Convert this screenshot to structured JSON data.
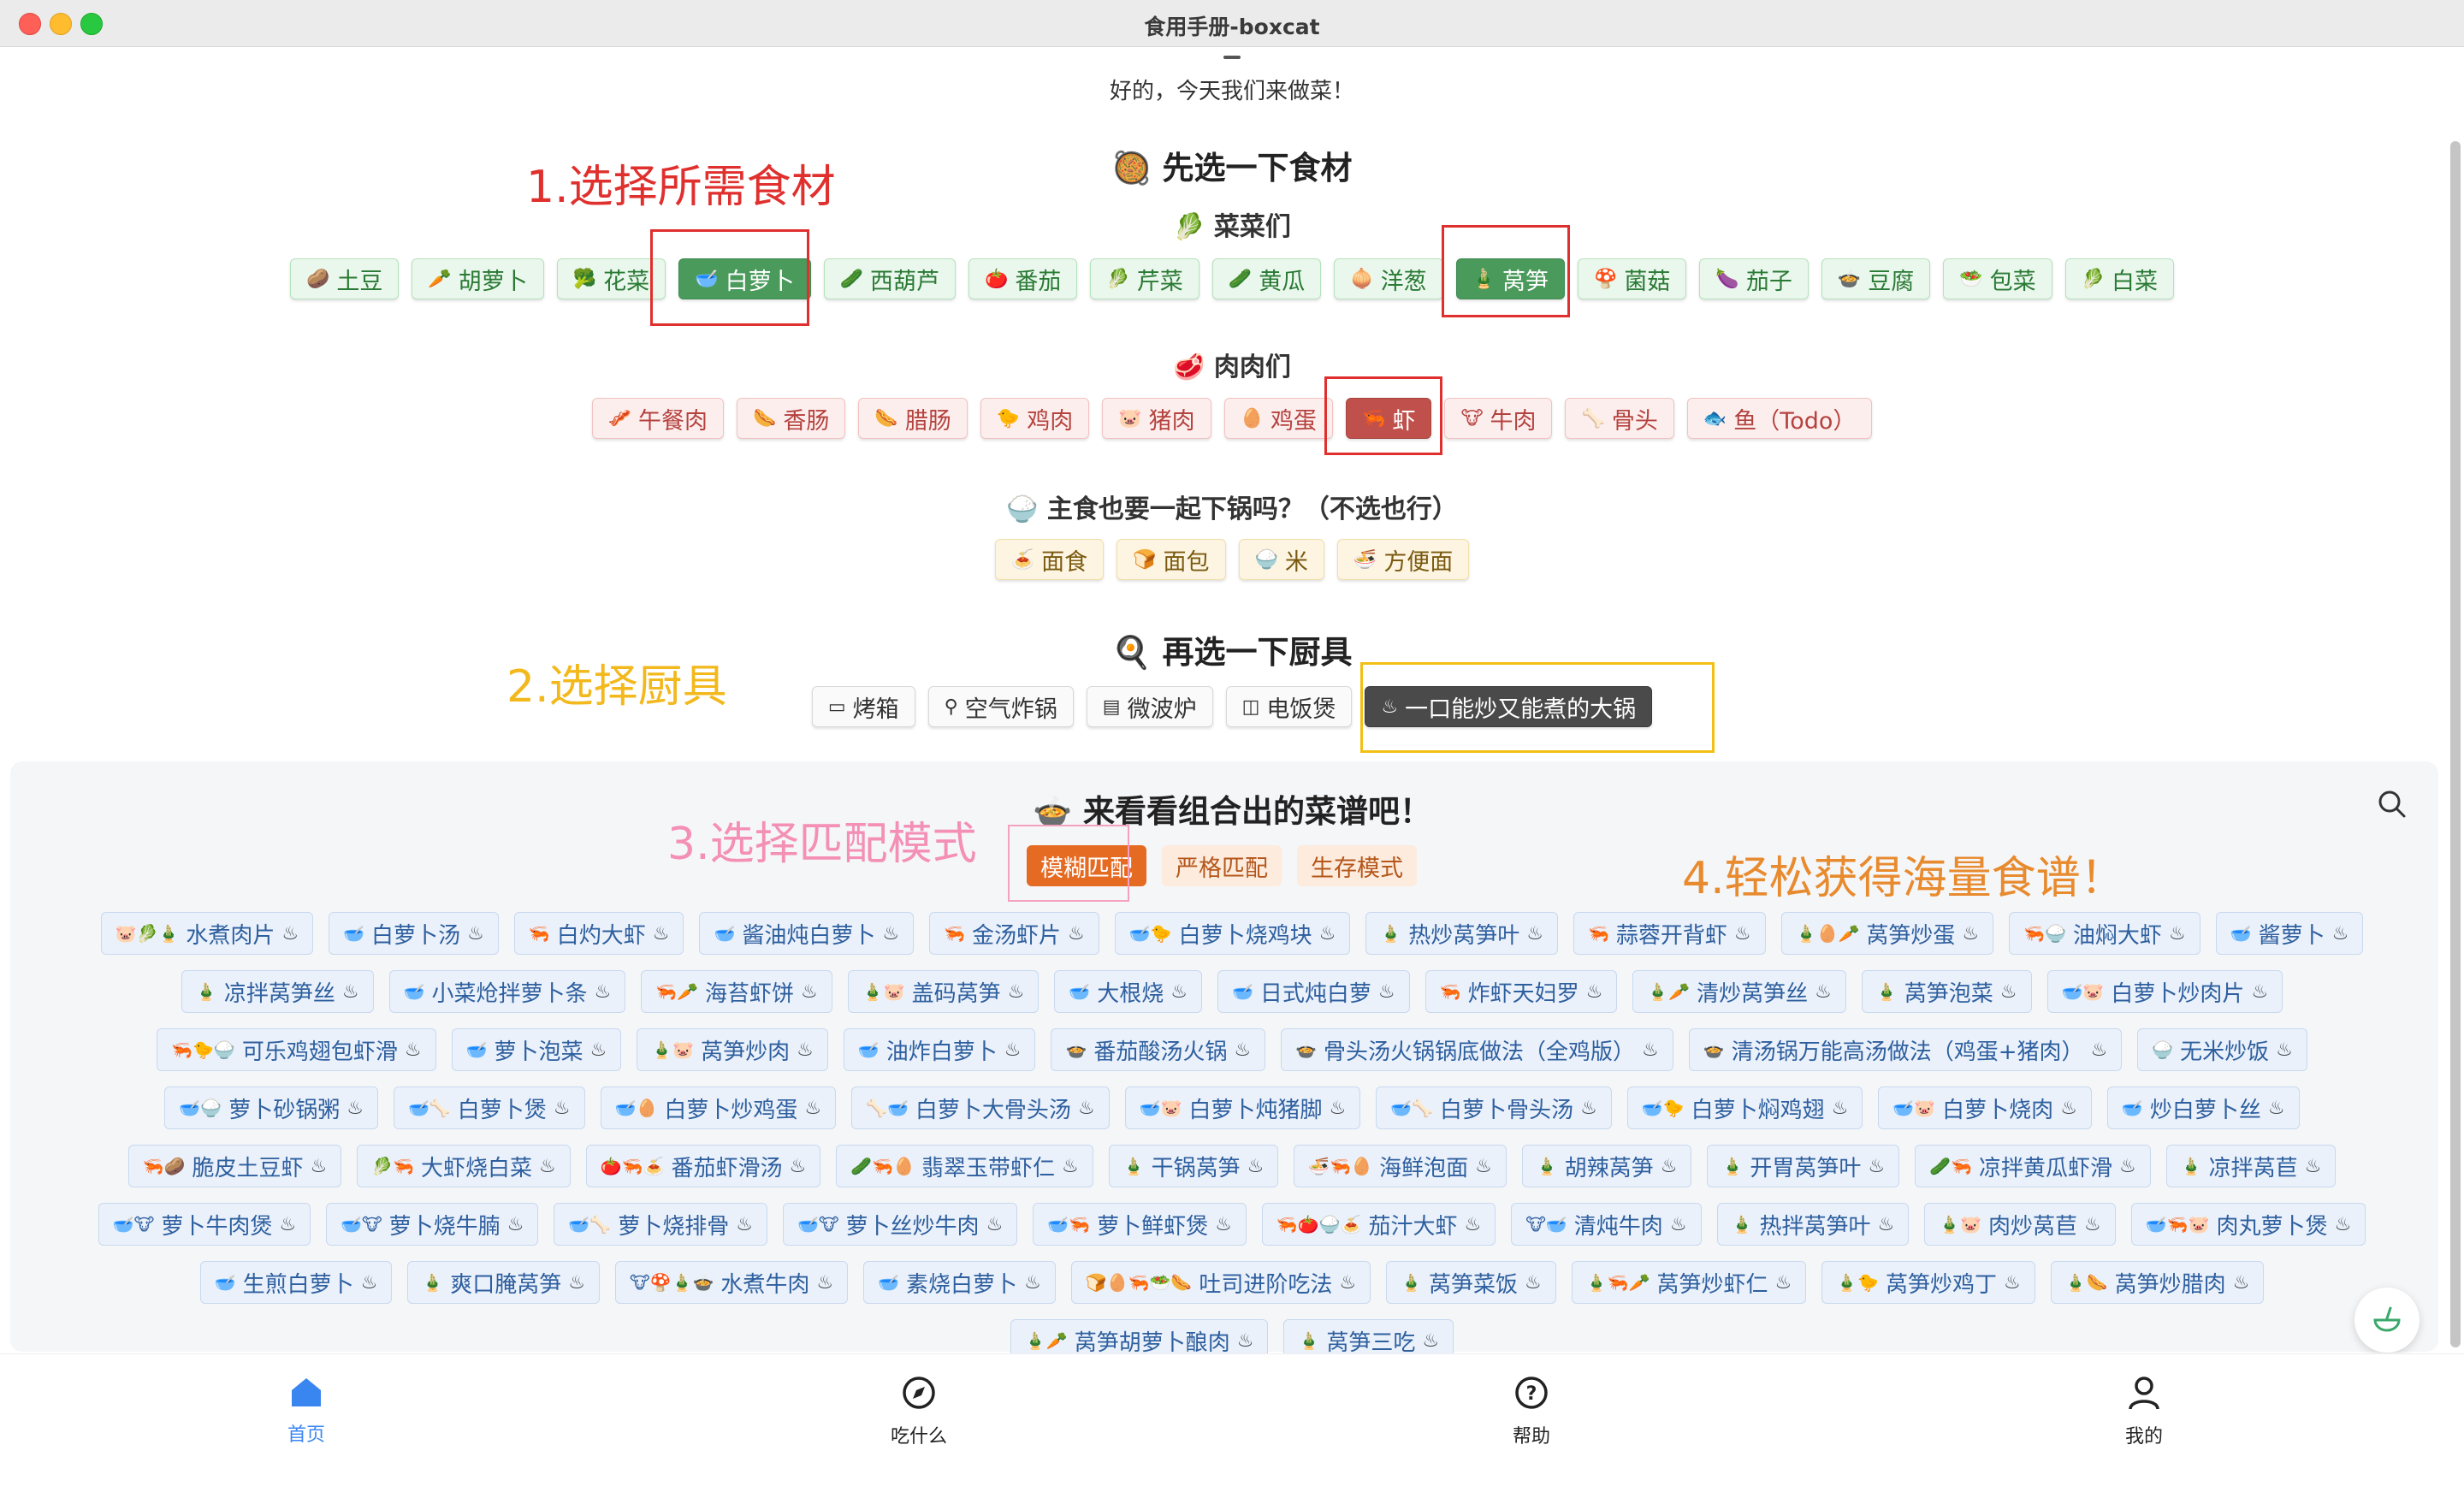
{
  "window": {
    "title": "食用手册-boxcat"
  },
  "greeting": "好的，今天我们来做菜！",
  "ingredients": {
    "heading_icon": "🥘",
    "heading": "先选一下食材",
    "veg_heading": "🥬 菜菜们",
    "veg": [
      {
        "emo": "🥔",
        "label": "土豆",
        "on": false
      },
      {
        "emo": "🥕",
        "label": "胡萝卜",
        "on": false
      },
      {
        "emo": "🥦",
        "label": "花菜",
        "on": false
      },
      {
        "emo": "🥣",
        "label": "白萝卜",
        "on": true
      },
      {
        "emo": "🥒",
        "label": "西葫芦",
        "on": false
      },
      {
        "emo": "🍅",
        "label": "番茄",
        "on": false
      },
      {
        "emo": "🥬",
        "label": "芹菜",
        "on": false
      },
      {
        "emo": "🥒",
        "label": "黄瓜",
        "on": false
      },
      {
        "emo": "🧅",
        "label": "洋葱",
        "on": false
      },
      {
        "emo": "🎍",
        "label": "莴笋",
        "on": true
      },
      {
        "emo": "🍄",
        "label": "菌菇",
        "on": false
      },
      {
        "emo": "🍆",
        "label": "茄子",
        "on": false
      },
      {
        "emo": "🍲",
        "label": "豆腐",
        "on": false
      },
      {
        "emo": "🥗",
        "label": "包菜",
        "on": false
      },
      {
        "emo": "🥬",
        "label": "白菜",
        "on": false
      }
    ],
    "meat_heading": "🥩 肉肉们",
    "meat": [
      {
        "emo": "🥓",
        "label": "午餐肉",
        "on": false
      },
      {
        "emo": "🌭",
        "label": "香肠",
        "on": false
      },
      {
        "emo": "🌭",
        "label": "腊肠",
        "on": false
      },
      {
        "emo": "🐤",
        "label": "鸡肉",
        "on": false
      },
      {
        "emo": "🐷",
        "label": "猪肉",
        "on": false
      },
      {
        "emo": "🥚",
        "label": "鸡蛋",
        "on": false
      },
      {
        "emo": "🦐",
        "label": "虾",
        "on": true
      },
      {
        "emo": "🐮",
        "label": "牛肉",
        "on": false
      },
      {
        "emo": "🦴",
        "label": "骨头",
        "on": false
      },
      {
        "emo": "🐟",
        "label": "鱼（Todo）",
        "on": false
      }
    ],
    "staple_heading": "🍚 主食也要一起下锅吗？（不选也行）",
    "staple": [
      {
        "emo": "🍝",
        "label": "面食"
      },
      {
        "emo": "🍞",
        "label": "面包"
      },
      {
        "emo": "🍚",
        "label": "米"
      },
      {
        "emo": "🍜",
        "label": "方便面"
      }
    ]
  },
  "tools": {
    "heading_icon": "🍳",
    "heading": "再选一下厨具",
    "items": [
      {
        "icon": "oven-icon",
        "glyph": "▭",
        "label": "烤箱",
        "on": false
      },
      {
        "icon": "air-fryer-icon",
        "glyph": "⚲",
        "label": "空气炸锅",
        "on": false
      },
      {
        "icon": "microwave-icon",
        "glyph": "▤",
        "label": "微波炉",
        "on": false
      },
      {
        "icon": "rice-cooker-icon",
        "glyph": "◫",
        "label": "电饭煲",
        "on": false
      },
      {
        "icon": "pot-icon",
        "glyph": "♨",
        "label": "一口能炒又能煮的大锅",
        "on": true
      }
    ]
  },
  "annotations": {
    "step1": "1.选择所需食材",
    "step2": "2.选择厨具",
    "step3": "3.选择匹配模式",
    "step4": "4.轻松获得海量食谱！",
    "step1_color": "#e0302e",
    "step2_color": "#f2b81c",
    "step3_color": "#f48fb6",
    "step4_color": "#e88a2e"
  },
  "recipes": {
    "heading": "🍲 来看看组合出的菜谱吧！",
    "modes": [
      {
        "label": "模糊匹配",
        "on": true
      },
      {
        "label": "严格匹配",
        "on": false
      },
      {
        "label": "生存模式",
        "on": false
      }
    ],
    "items": [
      {
        "emo": "🐷🥬🎍",
        "label": "水煮肉片"
      },
      {
        "emo": "🥣",
        "label": "白萝卜汤"
      },
      {
        "emo": "🦐",
        "label": "白灼大虾"
      },
      {
        "emo": "🥣",
        "label": "酱油炖白萝卜"
      },
      {
        "emo": "🦐",
        "label": "金汤虾片"
      },
      {
        "emo": "🥣🐤",
        "label": "白萝卜烧鸡块"
      },
      {
        "emo": "🎍",
        "label": "热炒莴笋叶"
      },
      {
        "emo": "🦐",
        "label": "蒜蓉开背虾"
      },
      {
        "emo": "🎍🥚🥕",
        "label": "莴笋炒蛋"
      },
      {
        "emo": "🦐🍚",
        "label": "油焖大虾"
      },
      {
        "emo": "🥣",
        "label": "酱萝卜"
      },
      {
        "emo": "🎍",
        "label": "凉拌莴笋丝"
      },
      {
        "emo": "🥣",
        "label": "小菜炝拌萝卜条"
      },
      {
        "emo": "🦐🥕",
        "label": "海苔虾饼"
      },
      {
        "emo": "🎍🐷",
        "label": "盖码莴笋"
      },
      {
        "emo": "🥣",
        "label": "大根烧"
      },
      {
        "emo": "🥣",
        "label": "日式炖白萝"
      },
      {
        "emo": "🦐",
        "label": "炸虾天妇罗"
      },
      {
        "emo": "🎍🥕",
        "label": "清炒莴笋丝"
      },
      {
        "emo": "🎍",
        "label": "莴笋泡菜"
      },
      {
        "emo": "🥣🐷",
        "label": "白萝卜炒肉片"
      },
      {
        "emo": "🦐🐤🍚",
        "label": "可乐鸡翅包虾滑"
      },
      {
        "emo": "🥣",
        "label": "萝卜泡菜"
      },
      {
        "emo": "🎍🐷",
        "label": "莴笋炒肉"
      },
      {
        "emo": "🥣",
        "label": "油炸白萝卜"
      },
      {
        "emo": "🍲",
        "label": "番茄酸汤火锅"
      },
      {
        "emo": "🍲",
        "label": "骨头汤火锅锅底做法（全鸡版）"
      },
      {
        "emo": "🍲",
        "label": "清汤锅万能高汤做法（鸡蛋+猪肉）"
      },
      {
        "emo": "🍚",
        "label": "无米炒饭"
      },
      {
        "emo": "🥣🍚",
        "label": "萝卜砂锅粥"
      },
      {
        "emo": "🥣🦴",
        "label": "白萝卜煲"
      },
      {
        "emo": "🥣🥚",
        "label": "白萝卜炒鸡蛋"
      },
      {
        "emo": "🦴🥣",
        "label": "白萝卜大骨头汤"
      },
      {
        "emo": "🥣🐷",
        "label": "白萝卜炖猪脚"
      },
      {
        "emo": "🥣🦴",
        "label": "白萝卜骨头汤"
      },
      {
        "emo": "🥣🐤",
        "label": "白萝卜焖鸡翅"
      },
      {
        "emo": "🥣🐷",
        "label": "白萝卜烧肉"
      },
      {
        "emo": "🥣",
        "label": "炒白萝卜丝"
      },
      {
        "emo": "🦐🥔",
        "label": "脆皮土豆虾"
      },
      {
        "emo": "🥬🦐",
        "label": "大虾烧白菜"
      },
      {
        "emo": "🍅🦐🍝",
        "label": "番茄虾滑汤"
      },
      {
        "emo": "🥒🦐🥚",
        "label": "翡翠玉带虾仁"
      },
      {
        "emo": "🎍",
        "label": "干锅莴笋"
      },
      {
        "emo": "🍜🦐🥚",
        "label": "海鲜泡面"
      },
      {
        "emo": "🎍",
        "label": "胡辣莴笋"
      },
      {
        "emo": "🎍",
        "label": "开胃莴笋叶"
      },
      {
        "emo": "🥒🦐",
        "label": "凉拌黄瓜虾滑"
      },
      {
        "emo": "🎍",
        "label": "凉拌莴苣"
      },
      {
        "emo": "🥣🐮",
        "label": "萝卜牛肉煲"
      },
      {
        "emo": "🥣🐮",
        "label": "萝卜烧牛腩"
      },
      {
        "emo": "🥣🦴",
        "label": "萝卜烧排骨"
      },
      {
        "emo": "🥣🐮",
        "label": "萝卜丝炒牛肉"
      },
      {
        "emo": "🥣🦐",
        "label": "萝卜鲜虾煲"
      },
      {
        "emo": "🦐🍅🍚🍝",
        "label": "茄汁大虾"
      },
      {
        "emo": "🐮🥣",
        "label": "清炖牛肉"
      },
      {
        "emo": "🎍",
        "label": "热拌莴笋叶"
      },
      {
        "emo": "🎍🐷",
        "label": "肉炒莴苣"
      },
      {
        "emo": "🥣🦐🐷",
        "label": "肉丸萝卜煲"
      },
      {
        "emo": "🥣",
        "label": "生煎白萝卜"
      },
      {
        "emo": "🎍",
        "label": "爽口腌莴笋"
      },
      {
        "emo": "🐮🍄🎍🍲",
        "label": "水煮牛肉"
      },
      {
        "emo": "🥣",
        "label": "素烧白萝卜"
      },
      {
        "emo": "🍞🥚🦐🥗🌭",
        "label": "吐司进阶吃法"
      },
      {
        "emo": "🎍",
        "label": "莴笋菜饭"
      },
      {
        "emo": "🎍🦐🥕",
        "label": "莴笋炒虾仁"
      },
      {
        "emo": "🎍🐤",
        "label": "莴笋炒鸡丁"
      },
      {
        "emo": "🎍🌭",
        "label": "莴笋炒腊肉"
      },
      {
        "emo": "🎍🥕",
        "label": "莴笋胡萝卜酿肉"
      },
      {
        "emo": "🎍",
        "label": "莴笋三吃"
      }
    ]
  },
  "nav": [
    {
      "icon": "home-icon",
      "label": "首页",
      "active": true
    },
    {
      "icon": "compass-icon",
      "label": "吃什么",
      "active": false
    },
    {
      "icon": "help-icon",
      "label": "帮助",
      "active": false
    },
    {
      "icon": "user-icon",
      "label": "我的",
      "active": false
    }
  ],
  "colors": {
    "accent_blue": "#3a86f0",
    "veg_selected": "#4a9a5c",
    "meat_selected": "#c0504b",
    "mode_selected": "#e56a22"
  }
}
